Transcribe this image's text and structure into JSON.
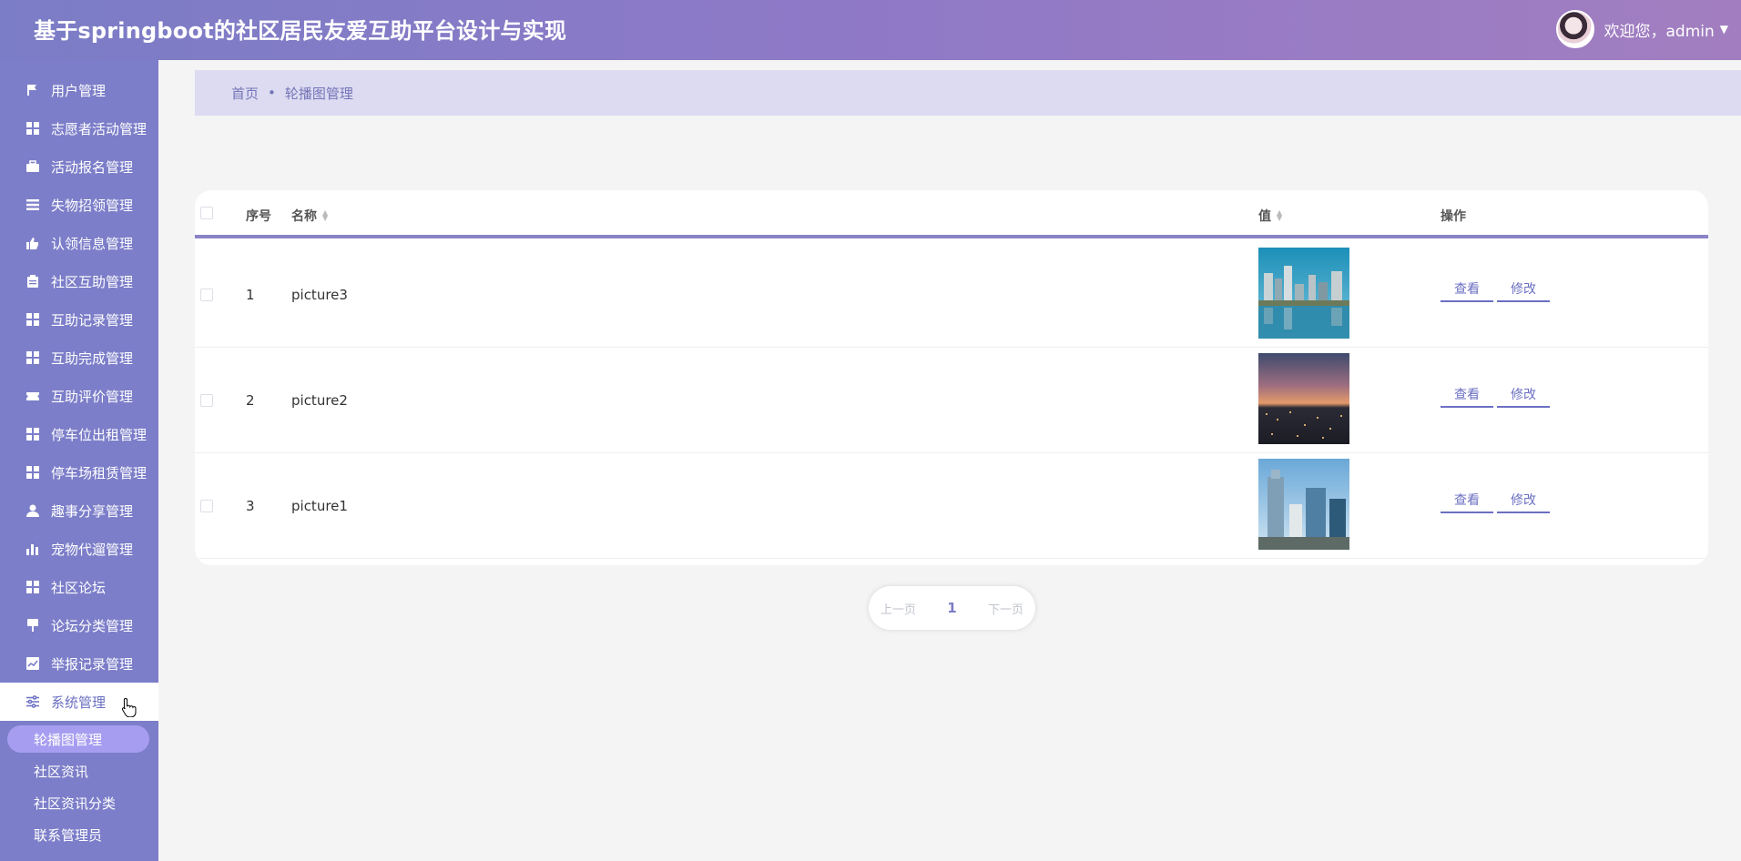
{
  "header": {
    "title": "基于springboot的社区居民友爱互助平台设计与实现",
    "welcome": "欢迎您，admin"
  },
  "sidebar": {
    "items": [
      {
        "label": "用户管理",
        "icon": "flag-icon"
      },
      {
        "label": "志愿者活动管理",
        "icon": "grid-icon"
      },
      {
        "label": "活动报名管理",
        "icon": "briefcase-icon"
      },
      {
        "label": "失物招领管理",
        "icon": "list-icon"
      },
      {
        "label": "认领信息管理",
        "icon": "thumbs-up-icon"
      },
      {
        "label": "社区互助管理",
        "icon": "clipboard-icon"
      },
      {
        "label": "互助记录管理",
        "icon": "grid-icon"
      },
      {
        "label": "互助完成管理",
        "icon": "grid-icon"
      },
      {
        "label": "互助评价管理",
        "icon": "ticket-icon"
      },
      {
        "label": "停车位出租管理",
        "icon": "grid-icon"
      },
      {
        "label": "停车场租赁管理",
        "icon": "grid-icon"
      },
      {
        "label": "趣事分享管理",
        "icon": "user-icon"
      },
      {
        "label": "宠物代遛管理",
        "icon": "bar-chart-icon"
      },
      {
        "label": "社区论坛",
        "icon": "grid-icon"
      },
      {
        "label": "论坛分类管理",
        "icon": "sign-icon"
      },
      {
        "label": "举报记录管理",
        "icon": "trend-chart-icon"
      },
      {
        "label": "系统管理",
        "icon": "sliders-icon"
      }
    ],
    "sub_items": [
      "轮播图管理",
      "社区资讯",
      "社区资讯分类",
      "联系管理员"
    ]
  },
  "breadcrumb": {
    "home": "首页",
    "sep": "•",
    "current": "轮播图管理"
  },
  "table": {
    "headers": {
      "index": "序号",
      "name": "名称",
      "value": "值",
      "action": "操作"
    },
    "rows": [
      {
        "index": "1",
        "name": "picture3",
        "image": "city-waterfront-photo"
      },
      {
        "index": "2",
        "name": "picture2",
        "image": "city-sunset-photo"
      },
      {
        "index": "3",
        "name": "picture1",
        "image": "city-buildings-photo"
      }
    ],
    "view_label": "查看",
    "edit_label": "修改"
  },
  "pager": {
    "prev": "上一页",
    "page": "1",
    "next": "下一页"
  },
  "colors": {
    "primary": "#7b7dc6",
    "accent": "#6b6fc2",
    "sidebar": "#7c7ec9",
    "breadcrumb_bg": "#dcdbf1"
  }
}
